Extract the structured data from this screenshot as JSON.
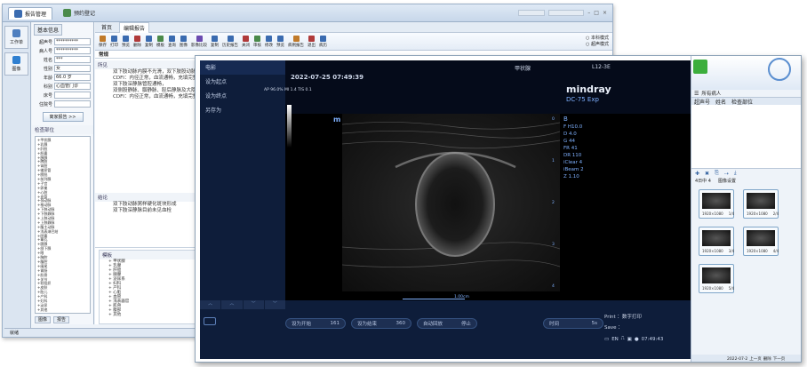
{
  "back_window": {
    "title_tabs": [
      {
        "label": "报告管理"
      },
      {
        "label": "预约登记"
      }
    ],
    "leftnav": [
      {
        "label": "工作单"
      },
      {
        "label": "图像"
      }
    ],
    "patient_tabs": [
      "基本信息"
    ],
    "patient_fields": [
      {
        "label": "超声号",
        "value": "**********"
      },
      {
        "label": "病人号",
        "value": "**********"
      },
      {
        "label": "姓名",
        "value": "***"
      },
      {
        "label": "性别",
        "value": "女"
      },
      {
        "label": "年龄",
        "value": "66.0   岁"
      },
      {
        "label": "科别",
        "value": "心血管门诊"
      },
      {
        "label": "床号",
        "value": ""
      },
      {
        "label": "住院号",
        "value": ""
      }
    ],
    "history_button": "离家报告 >>",
    "tree_title": "检查部位",
    "tree_items": [
      "+甲状腺",
      "+乳腺",
      "+肝胆",
      "+胆囊",
      "+胰腺",
      "+脾脏",
      "+肾脏",
      "+输尿管",
      "+膀胱",
      "+前列腺",
      "+子宫",
      "+卵巢",
      "+心脏",
      "+血管",
      "+颈动脉",
      "+椎动脉",
      "+下肢动脉",
      "+下肢静脉",
      "+上肢动脉",
      "+上肢静脉",
      "+腹主动脉",
      "+浅表淋巴结",
      "+阴囊",
      "+睾丸",
      "+腮腺",
      "+颌下腺",
      "+眼",
      "+胸腔",
      "+腹腔",
      "+阑尾",
      "+胃肠",
      "+肌骨",
      "+关节",
      "+软组织",
      "+皮肤",
      "+胎儿",
      "+产科",
      "+妇科",
      "+泌尿",
      "+其他"
    ],
    "panel_bottom": [
      "图像",
      "报告"
    ],
    "doc_tabs": [
      {
        "label": "首页"
      },
      {
        "label": "编辑报告"
      }
    ],
    "toolbar": [
      "保存",
      "打印",
      "预览",
      "删除",
      "复制",
      "模板",
      "查询",
      "图像",
      "影像比较",
      "复制",
      "历史报告",
      "关闭",
      "审核",
      "修改",
      "预览",
      "病例报告",
      "退出",
      "病历"
    ],
    "options": [
      "○ 本科模式",
      "○ 超声模式"
    ],
    "sub_tab": "常规",
    "findings_label": "所见",
    "findings_lines": [
      "双下肢动脉内膜不光滑，双下肢股动脉、股浅动脉、腘动脉、",
      "CDFI：内径正常，血流通畅，充填完整。",
      "双下肢深静脉管腔通畅，",
      "双侧股静脉、腘静脉、胫后静脉及大隐静脉",
      "CDFI：内径正常，血流通畅，充填完整。"
    ],
    "conclusion_label": "结论",
    "conclusion_lines": [
      "双下肢动脉粥样硬化斑块形成",
      "双下肢深静脉目前未见血栓"
    ],
    "template_label": "模板",
    "template_items": [
      "+ 甲状腺",
      "+ 乳腺",
      "+ 肝胆",
      "+ 胰腺",
      "+ 泌尿系",
      "+ 妇科",
      "+ 产科",
      "+ 心脏",
      "+ 血管",
      "+ 浅表器官",
      "+ 肌骨",
      "+ 腹部",
      "+ 其他"
    ],
    "status": "就绪"
  },
  "ultrasound": {
    "left_menu": [
      "电影",
      "设为起点",
      "设为终点",
      "另存为"
    ],
    "header_organ": "甲状腺",
    "probe": "L12-3E",
    "datetime": "2022-07-25   07:49:39",
    "info_line": "AP 96.0%  MI 1.4  TIS 0.1",
    "logo": "mindray",
    "model": "DC-75 Exp",
    "mode": "B",
    "params": [
      "F H10.0",
      "D 4.0",
      "G 44",
      "FR 41",
      "DR 110",
      "iClear 4",
      "iBeam 2",
      "Z 1.10"
    ],
    "depth_ticks": [
      "0",
      "1",
      "2",
      "3",
      "4"
    ],
    "scale_label": "1.00cm",
    "bottom_buttons": [
      {
        "label": "设为开始",
        "value": "161"
      },
      {
        "label": "设为结束",
        "value": "360"
      },
      {
        "label": "自动回放",
        "value": "停止"
      }
    ],
    "time_button": {
      "label": "时间",
      "value": "5s"
    },
    "print_label": "Print ：数字打印",
    "save_label": "Save ：",
    "status_time": "07:49:43",
    "status_lang": "EN"
  },
  "right_panel": {
    "header": "所有病人",
    "columns": [
      "超声号",
      "姓名",
      "检查部位"
    ],
    "image_label": "4日中 4",
    "image_sort": "图像设置",
    "thumbnails": [
      {
        "caption": "1920×1080",
        "index": "1/4"
      },
      {
        "caption": "1920×1080",
        "index": "2/4"
      },
      {
        "caption": "1920×1080",
        "index": "3/4"
      },
      {
        "caption": "1920×1080",
        "index": "4/4"
      },
      {
        "caption": "1920×1080",
        "index": "5/4"
      }
    ],
    "footer_date": "2022-07-2",
    "footer_btns": [
      "上一页",
      "删除",
      "下一页"
    ]
  },
  "colors": {
    "accent": "#2f5f9e",
    "us_panel": "#0e1d3a",
    "us_text": "#c9d6ee"
  }
}
